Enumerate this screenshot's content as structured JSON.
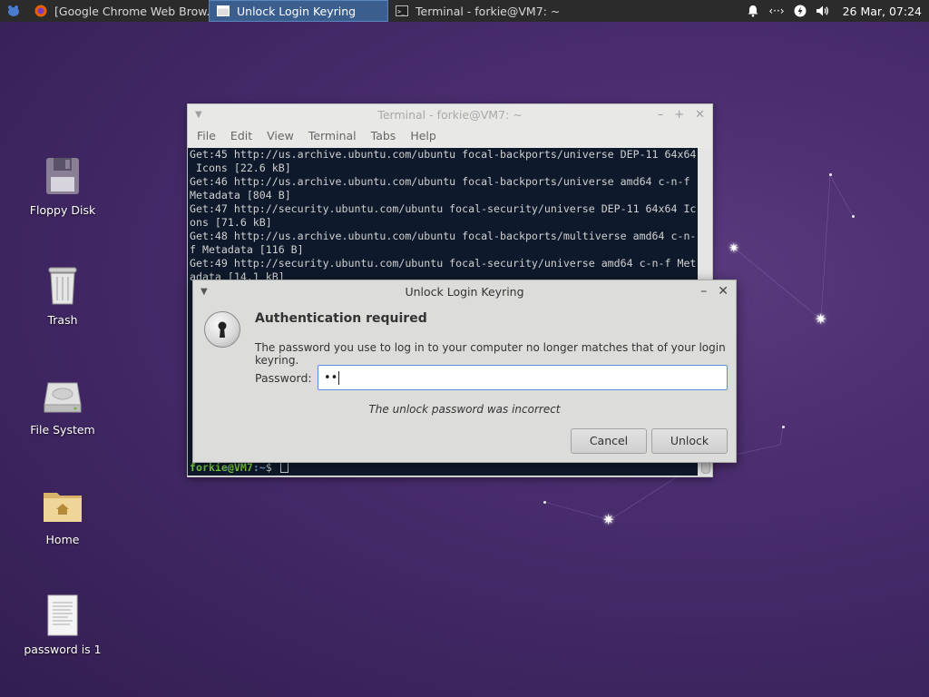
{
  "panel": {
    "tasks": [
      {
        "label": "[Google Chrome Web Brow...",
        "icon": "firefox-icon"
      },
      {
        "label": "Unlock Login Keyring",
        "icon": "window-icon"
      },
      {
        "label": "Terminal - forkie@VM7: ~",
        "icon": "terminal-icon"
      }
    ],
    "clock": "26 Mar, 07:24"
  },
  "desktop_icons": [
    {
      "label": "Floppy Disk",
      "icon": "floppy-disk-icon"
    },
    {
      "label": "Trash",
      "icon": "trash-icon"
    },
    {
      "label": "File System",
      "icon": "hard-drive-icon"
    },
    {
      "label": "Home",
      "icon": "home-folder-icon"
    },
    {
      "label": "password is 1",
      "icon": "text-file-icon"
    }
  ],
  "terminal": {
    "title": "Terminal - forkie@VM7: ~",
    "menu": [
      "File",
      "Edit",
      "View",
      "Terminal",
      "Tabs",
      "Help"
    ],
    "lines": [
      "Get:45 http://us.archive.ubuntu.com/ubuntu focal-backports/universe DEP-11 64x64",
      " Icons [22.6 kB]",
      "Get:46 http://us.archive.ubuntu.com/ubuntu focal-backports/universe amd64 c-n-f",
      "Metadata [804 B]",
      "Get:47 http://security.ubuntu.com/ubuntu focal-security/universe DEP-11 64x64 Ic",
      "ons [71.6 kB]",
      "Get:48 http://us.archive.ubuntu.com/ubuntu focal-backports/multiverse amd64 c-n-",
      "f Metadata [116 B]",
      "Get:49 http://security.ubuntu.com/ubuntu focal-security/universe amd64 c-n-f Met",
      "adata [14.1 kB]"
    ],
    "prompt_user": "forkie@VM7",
    "prompt_path": ":~",
    "prompt_symbol": "$"
  },
  "dialog": {
    "title": "Unlock Login Keyring",
    "heading": "Authentication required",
    "message": "The password you use to log in to your computer no longer matches that of your login keyring.",
    "password_label": "Password:",
    "password_value": "••",
    "error": "The unlock password was incorrect",
    "cancel_label": "Cancel",
    "unlock_label": "Unlock"
  }
}
